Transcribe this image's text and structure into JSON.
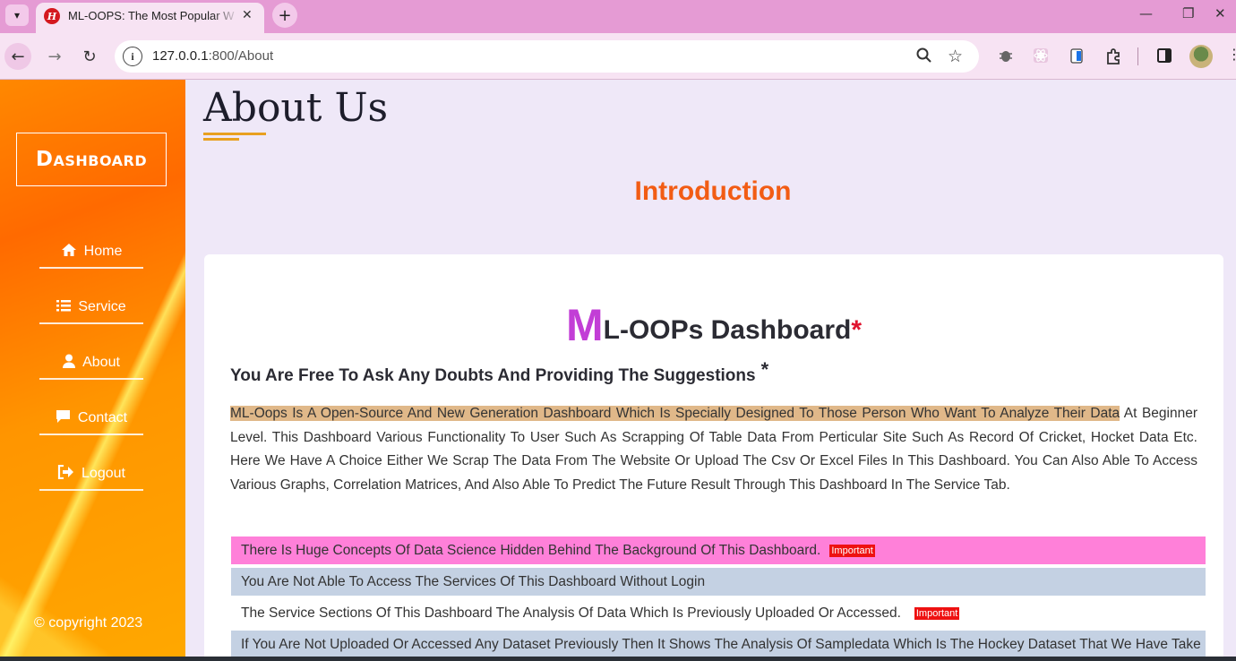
{
  "browser": {
    "tab_title": "ML-OOPS: The Most Popular W",
    "tab_favicon_letter": "H",
    "url_host": "127.0.0.1",
    "url_path": ":800/About",
    "icons": [
      "tab-list-icon",
      "close-icon",
      "plus-icon",
      "minimize-icon",
      "restore-icon",
      "close-window-icon",
      "back-icon",
      "forward-icon",
      "reload-icon",
      "site-info-icon",
      "zoom-icon",
      "bookmark-star-icon",
      "extension-icon",
      "side-panel-icon",
      "profile-avatar"
    ]
  },
  "sidebar": {
    "logo": "Dashboard",
    "items": [
      {
        "label": "Home",
        "icon": "home-icon"
      },
      {
        "label": "Service",
        "icon": "list-icon"
      },
      {
        "label": "About",
        "icon": "user-icon"
      },
      {
        "label": "Contact",
        "icon": "chat-icon"
      },
      {
        "label": "Logout",
        "icon": "logout-icon"
      }
    ],
    "copyright": "© copyright 2023"
  },
  "main": {
    "title": "About Us",
    "section": "Introduction",
    "card": {
      "heading_first": "M",
      "heading_rest": "L-OOPs Dashboard",
      "heading_star": "*",
      "subheading": "You Are Free To Ask Any Doubts And Providing The Suggestions",
      "subheading_star": "*",
      "para_highlight": "ML-Oops Is A Open-Source And New Generation Dashboard Which Is Specially Designed To Those Person Who Want To Analyze Their Data",
      "para_rest": " At Beginner Level. This Dashboard Various Functionality To User Such As Scrapping Of Table Data From Perticular Site Such As Record Of Cricket, Hocket Data Etc. Here We Have A Choice Either We Scrap The Data From The Website Or Upload The Csv Or Excel Files In This Dashboard. You Can Also Able To Access Various Graphs, Correlation Matrices, And Also Able To Predict The Future Result Through This Dashboard In The Service Tab.",
      "list": [
        {
          "text": "There Is Huge Concepts Of Data Science Hidden Behind The Background Of This Dashboard.",
          "badge": "Important",
          "style": "pink"
        },
        {
          "text": "You Are Not Able To Access The Services Of This Dashboard Without Login",
          "badge": "",
          "style": "grey"
        },
        {
          "text": "The Service Sections Of This Dashboard The Analysis Of Data Which Is Previously Uploaded Or Accessed.",
          "badge": "Important",
          "style": "plain"
        },
        {
          "text": "If You Are Not Uploaded Or Accessed Any Dataset Previously Then It Shows The Analysis Of Sampledata Which Is The Hockey Dataset That We Have Take",
          "badge": "",
          "style": "grey"
        }
      ]
    }
  }
}
